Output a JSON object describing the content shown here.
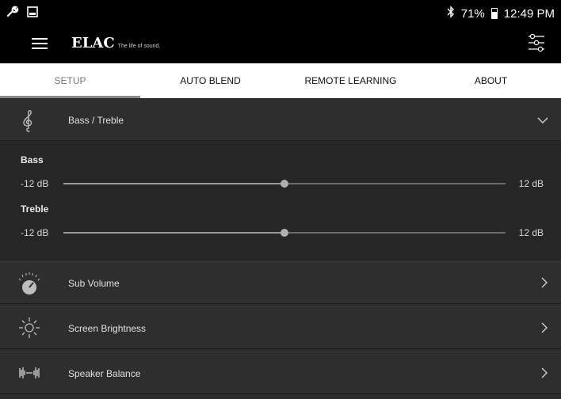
{
  "status_bar": {
    "battery": "71%",
    "time": "12:49 PM",
    "icons": [
      "wrench-icon",
      "image-icon",
      "bluetooth-icon",
      "battery-icon"
    ]
  },
  "app_bar": {
    "brand": "ELAC",
    "tagline": "The life of sound.",
    "icons": [
      "menu-icon",
      "equalizer-settings-icon"
    ]
  },
  "tabs": [
    {
      "label": "SETUP",
      "active": true
    },
    {
      "label": "AUTO BLEND",
      "active": false
    },
    {
      "label": "REMOTE LEARNING",
      "active": false
    },
    {
      "label": "ABOUT",
      "active": false
    }
  ],
  "bass_treble": {
    "title": "Bass / Treble",
    "icon": "treble-clef-icon",
    "expanded": true,
    "bass": {
      "label": "Bass",
      "min": "-12 dB",
      "max": "12 dB",
      "value_fraction": 0.5
    },
    "treble": {
      "label": "Treble",
      "min": "-12 dB",
      "max": "12 dB",
      "value_fraction": 0.5
    }
  },
  "rows": [
    {
      "label": "Sub Volume",
      "icon": "volume-knob-icon"
    },
    {
      "label": "Screen Brightness",
      "icon": "brightness-icon"
    },
    {
      "label": "Speaker Balance",
      "icon": "speaker-balance-icon"
    }
  ],
  "colors": {
    "background": "#2b2b2b",
    "tabs_bg": "#ffffff",
    "accent": "#9a9a9a"
  }
}
